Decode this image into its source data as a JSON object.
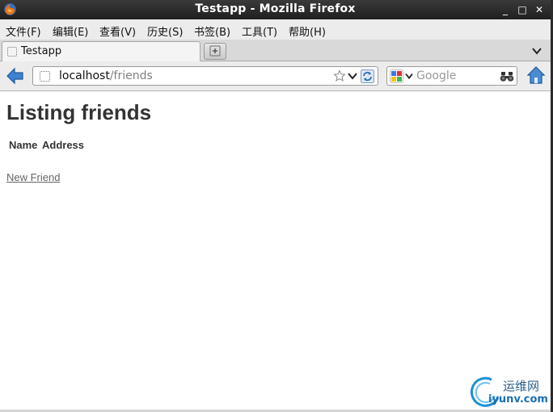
{
  "window": {
    "title": "Testapp - Mozilla Firefox",
    "minimize_glyph": "_",
    "maximize_glyph": "□",
    "close_glyph": "✕"
  },
  "menubar": {
    "items": [
      {
        "label": "文件(F)"
      },
      {
        "label": "编辑(E)"
      },
      {
        "label": "查看(V)"
      },
      {
        "label": "历史(S)"
      },
      {
        "label": "书签(B)"
      },
      {
        "label": "工具(T)"
      },
      {
        "label": "帮助(H)"
      }
    ]
  },
  "tabs": [
    {
      "label": "Testapp",
      "active": true
    }
  ],
  "navbar": {
    "url_host": "localhost",
    "url_path": "/friends",
    "search_placeholder": "Google"
  },
  "page": {
    "heading": "Listing friends",
    "columns": [
      "Name",
      "Address"
    ],
    "new_link": "New Friend"
  },
  "watermark": {
    "text_cn": "运维网",
    "text_en": "iyunv.com"
  },
  "colors": {
    "titlebar": "#2b2b2b",
    "chrome": "#ececec",
    "accent_blue": "#2f6fb8"
  },
  "icons": [
    "firefox-icon",
    "new-tab-icon",
    "back-arrow-icon",
    "page-icon",
    "star-icon",
    "reload-icon",
    "google-icon",
    "binoculars-icon",
    "home-icon"
  ]
}
